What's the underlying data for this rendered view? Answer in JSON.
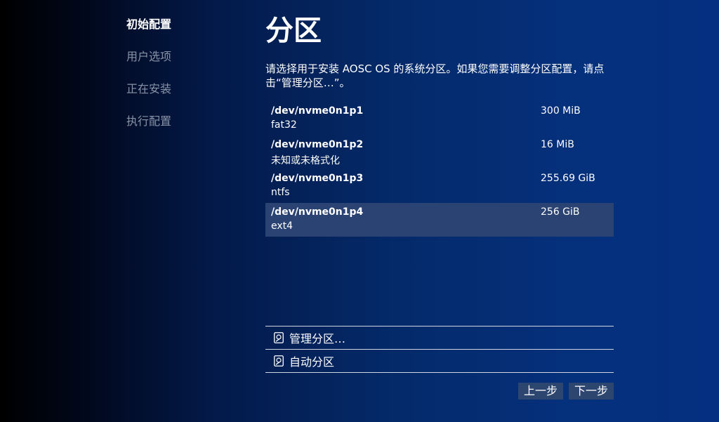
{
  "sidebar": {
    "steps": [
      {
        "label": "初始配置",
        "active": true
      },
      {
        "label": "用户选项",
        "active": false
      },
      {
        "label": "正在安装",
        "active": false
      },
      {
        "label": "执行配置",
        "active": false
      }
    ]
  },
  "main": {
    "title": "分区",
    "description": "请选择用于安装 AOSC OS 的系统分区。如果您需要调整分区配置，请点击“管理分区…”。",
    "partitions": [
      {
        "path": "/dev/nvme0n1p1",
        "fs": "fat32",
        "size": "300 MiB"
      },
      {
        "path": "/dev/nvme0n1p2",
        "fs": "未知或未格式化",
        "size": "16 MiB"
      },
      {
        "path": "/dev/nvme0n1p3",
        "fs": "ntfs",
        "size": "255.69 GiB"
      },
      {
        "path": "/dev/nvme0n1p4",
        "fs": "ext4",
        "size": "256 GiB",
        "selected": true
      }
    ],
    "actions": [
      {
        "label": "管理分区…",
        "icon": "disk-edit-icon"
      },
      {
        "label": "自动分区",
        "icon": "disk-edit-icon"
      }
    ]
  },
  "nav": {
    "back_label": "上一步",
    "next_label": "下一步"
  },
  "colors": {
    "selected_row": "#2a4373",
    "button_bg": "#2c4670",
    "inactive_step": "#8a93a6"
  }
}
